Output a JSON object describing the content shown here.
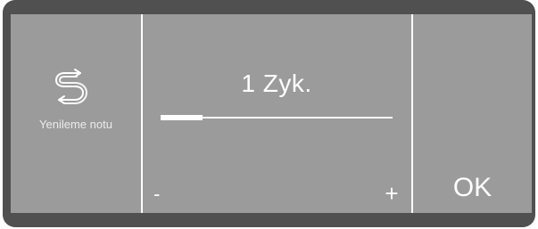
{
  "mode": {
    "icon": "rinse-cycle-icon",
    "label": "Yenileme notu"
  },
  "setting": {
    "value_text": "1 Zyk.",
    "level": 0.18
  },
  "controls": {
    "minus_label": "-",
    "plus_label": "+",
    "ok_label": "OK"
  },
  "colors": {
    "screen": "#9b9b9b",
    "bezel": "#505050",
    "foreground": "#ffffff"
  }
}
